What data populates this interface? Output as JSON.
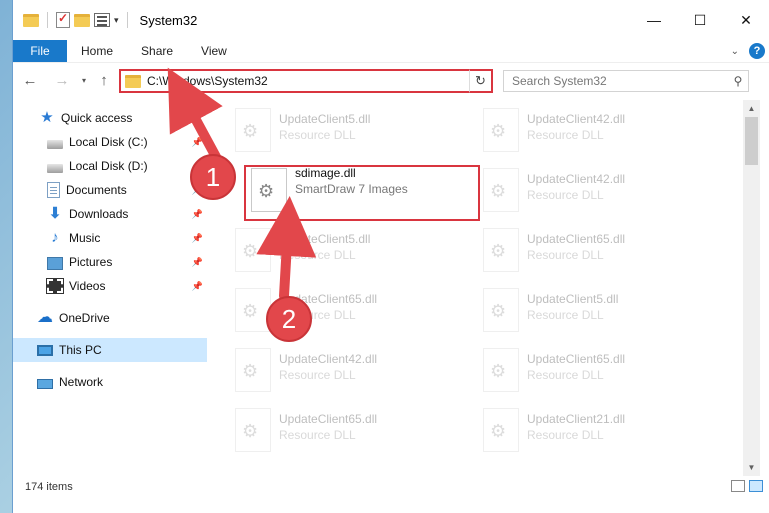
{
  "window": {
    "title": "System32"
  },
  "ribbon": {
    "tabs": [
      "File",
      "Home",
      "Share",
      "View"
    ]
  },
  "controls": {
    "minimize": "—",
    "maximize": "☐",
    "close": "✕"
  },
  "address": {
    "path": "C:\\Windows\\System32"
  },
  "search": {
    "placeholder": "Search System32"
  },
  "nav": {
    "items": [
      {
        "label": "Quick access",
        "icon": "star-icon"
      },
      {
        "label": "Local Disk (C:)",
        "icon": "disk-icon"
      },
      {
        "label": "Local Disk (D:)",
        "icon": "disk-icon"
      },
      {
        "label": "Documents",
        "icon": "documents-icon"
      },
      {
        "label": "Downloads",
        "icon": "downloads-icon"
      },
      {
        "label": "Music",
        "icon": "music-icon"
      },
      {
        "label": "Pictures",
        "icon": "pictures-icon"
      },
      {
        "label": "Videos",
        "icon": "videos-icon"
      },
      {
        "label": "OneDrive",
        "icon": "onedrive-icon"
      },
      {
        "label": "This PC",
        "icon": "this-pc-icon"
      },
      {
        "label": "Network",
        "icon": "network-icon"
      }
    ]
  },
  "files": {
    "left": [
      {
        "name": "UpdateClient5.dll",
        "type": "Resource DLL"
      },
      {
        "name": "sdimage.dll",
        "type": "SmartDraw 7 Images"
      },
      {
        "name": "UpdateClient5.dll",
        "type": "Resource DLL"
      },
      {
        "name": "UpdateClient65.dll",
        "type": "Resource DLL"
      },
      {
        "name": "UpdateClient42.dll",
        "type": "Resource DLL"
      },
      {
        "name": "UpdateClient65.dll",
        "type": "Resource DLL"
      }
    ],
    "right": [
      {
        "name": "UpdateClient42.dll",
        "type": "Resource DLL"
      },
      {
        "name": "UpdateClient42.dll",
        "type": "Resource DLL"
      },
      {
        "name": "UpdateClient65.dll",
        "type": "Resource DLL"
      },
      {
        "name": "UpdateClient5.dll",
        "type": "Resource DLL"
      },
      {
        "name": "UpdateClient65.dll",
        "type": "Resource DLL"
      },
      {
        "name": "UpdateClient21.dll",
        "type": "Resource DLL"
      }
    ]
  },
  "status": {
    "count": "174 items"
  },
  "callouts": [
    "1",
    "2"
  ],
  "colors": {
    "accent": "#1979ca",
    "highlight": "#d9353f",
    "callout": "#e2474b"
  }
}
